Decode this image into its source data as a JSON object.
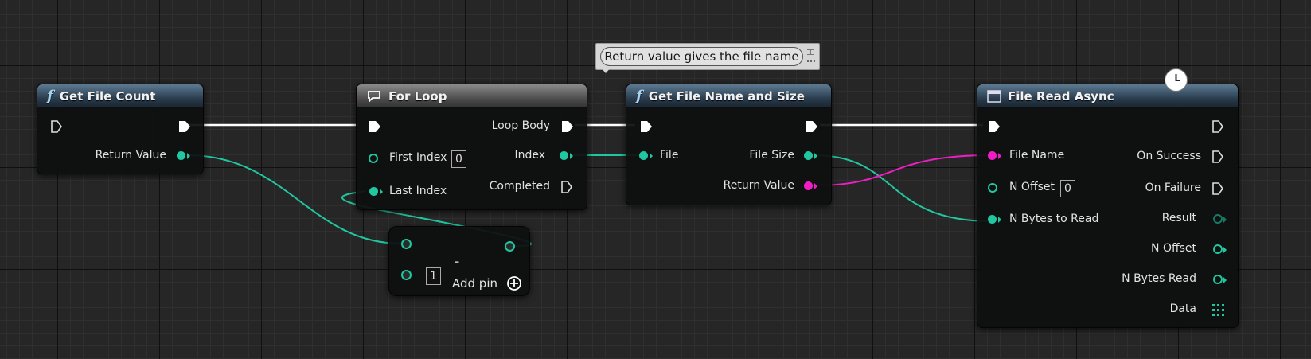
{
  "comment": {
    "text": "Return value gives the file name"
  },
  "nodes": {
    "get_file_count": {
      "title": "Get File Count",
      "return_value": "Return Value"
    },
    "for_loop": {
      "title": "For Loop",
      "first_index": "First Index",
      "first_index_value": "0",
      "last_index": "Last Index",
      "loop_body": "Loop Body",
      "index": "Index",
      "completed": "Completed"
    },
    "subtract": {
      "operator": "-",
      "b_value": "1",
      "add_pin": "Add pin"
    },
    "get_file_name_size": {
      "title": "Get File Name and Size",
      "file": "File",
      "file_size": "File Size",
      "return_value": "Return Value"
    },
    "file_read_async": {
      "title": "File Read Async",
      "file_name": "File Name",
      "n_offset_in": "N Offset",
      "n_offset_value": "0",
      "n_bytes_to_read": "N Bytes to Read",
      "on_success": "On Success",
      "on_failure": "On Failure",
      "result": "Result",
      "n_offset_out": "N Offset",
      "n_bytes_read": "N Bytes Read",
      "data": "Data"
    }
  },
  "colors": {
    "integer_pin": "#20c7a0",
    "string_pin": "#ef1ec4",
    "exec_wire": "#ffffff",
    "header_function": "#3a5468",
    "header_macro": "#5a5a5a"
  }
}
